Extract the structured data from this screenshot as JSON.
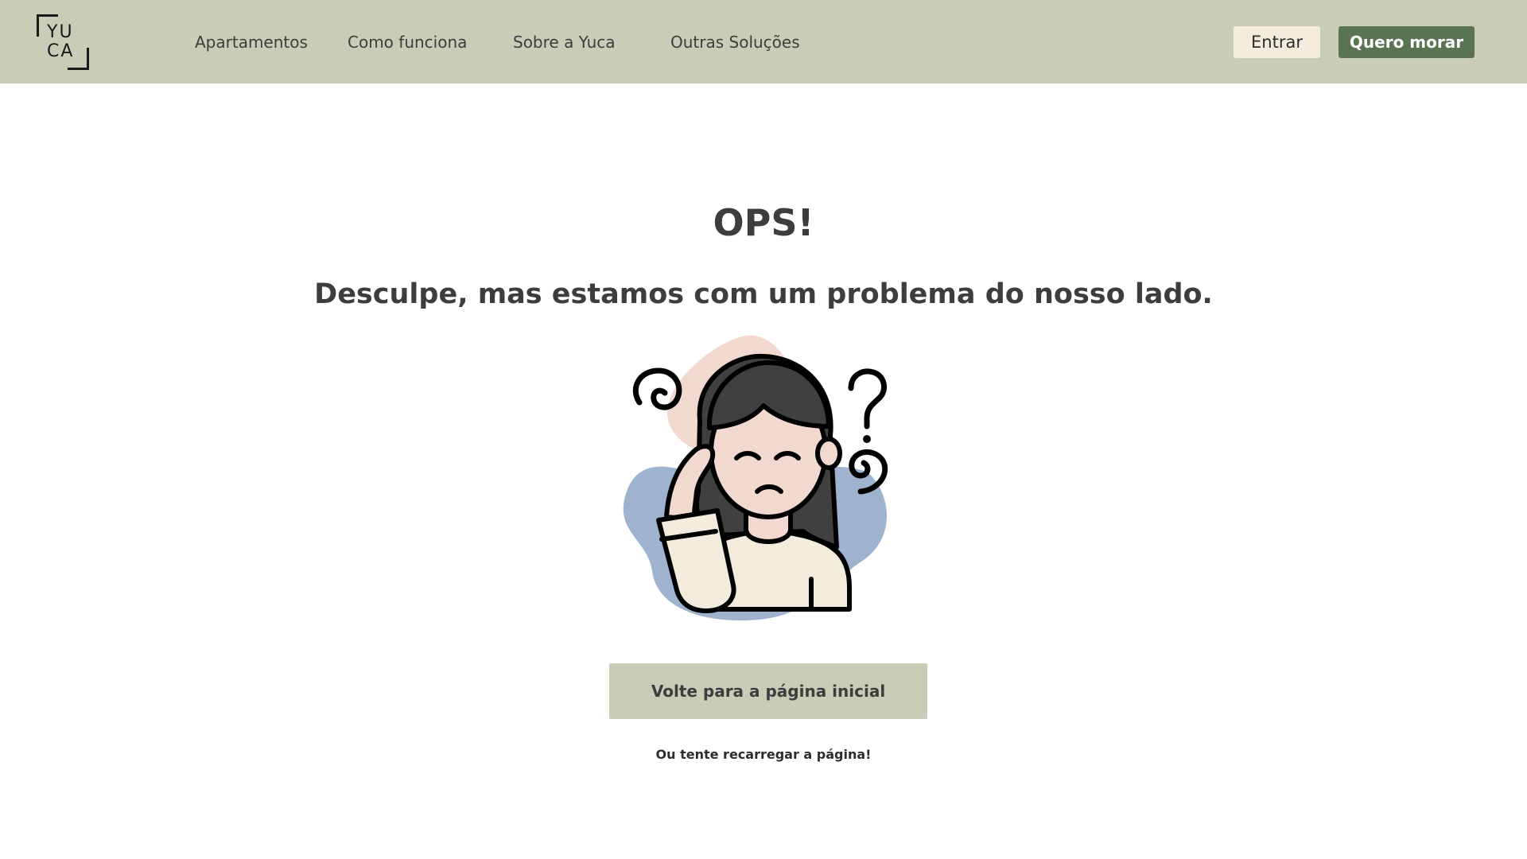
{
  "header": {
    "logo": {
      "line1": "YU",
      "line2": "CA"
    },
    "nav": [
      {
        "label": "Apartamentos"
      },
      {
        "label": "Como funciona"
      },
      {
        "label": "Sobre a Yuca"
      },
      {
        "label": "Outras Soluções"
      }
    ],
    "login_label": "Entrar",
    "cta_label": "Quero morar"
  },
  "main": {
    "title": "OPS!",
    "subtitle": "Desculpe, mas estamos com um problema do nosso lado.",
    "illustration_icon": "confused-woman-illustration",
    "home_button_label": "Volte para a página inicial",
    "reload_hint": "Ou tente recarregar a página!"
  },
  "colors": {
    "header_bg": "#c9cdb8",
    "primary_green": "#5a7352",
    "cream": "#f3ecdc",
    "text_dark": "#3d3d3d",
    "blob_pink": "#f2d9d0",
    "blob_blue": "#9fb3cf"
  }
}
